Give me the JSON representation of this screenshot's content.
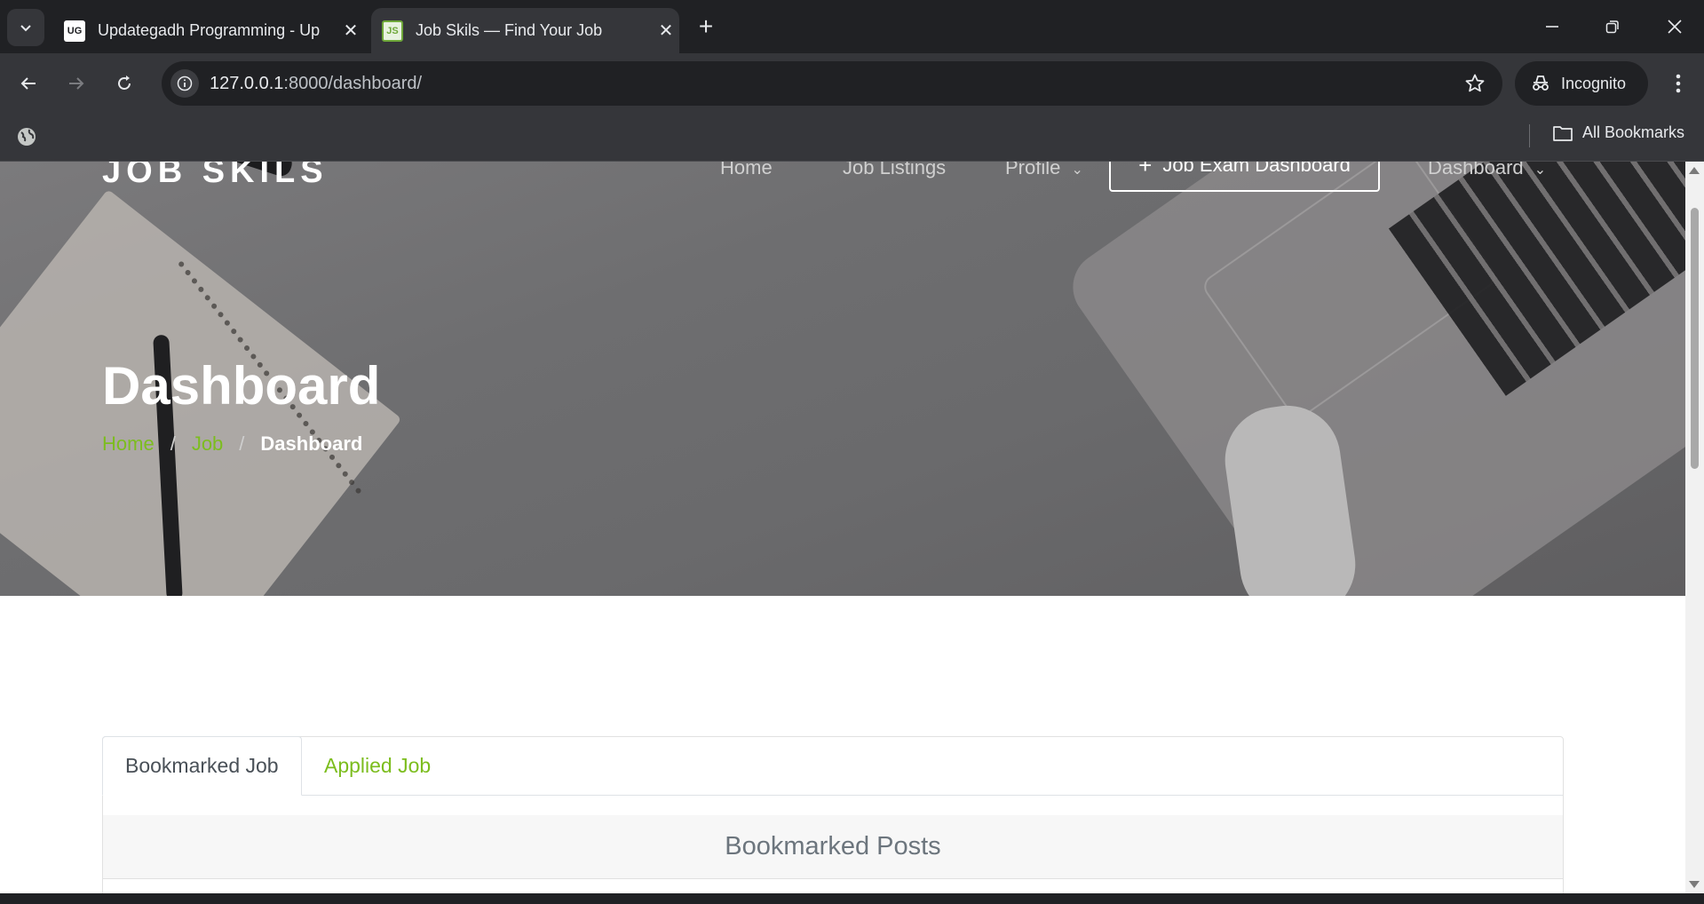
{
  "browser": {
    "tabs": [
      {
        "title": "Updategadh Programming - Up",
        "favicon": "UG",
        "active": false
      },
      {
        "title": "Job Skils — Find Your Job",
        "favicon": "JS",
        "active": true
      }
    ],
    "url_host": "127.0.0.1",
    "url_path": ":8000/dashboard/",
    "incognito_label": "Incognito",
    "all_bookmarks_label": "All Bookmarks"
  },
  "site": {
    "logo": "JOB SKILS",
    "nav": {
      "home": "Home",
      "job_listings": "Job Listings",
      "profile": "Profile",
      "cta": "Job Exam Dashboard",
      "dashboard": "Dashboard"
    }
  },
  "hero": {
    "title": "Dashboard",
    "breadcrumb": {
      "home": "Home",
      "sep": "/",
      "job": "Job",
      "current": "Dashboard"
    }
  },
  "tabs_card": {
    "tabs": [
      "Bookmarked Job",
      "Applied Job"
    ],
    "header": "Bookmarked Posts"
  },
  "colors": {
    "accent": "#7cbd1e",
    "chrome_dark": "#202124",
    "chrome_mid": "#35363a"
  }
}
